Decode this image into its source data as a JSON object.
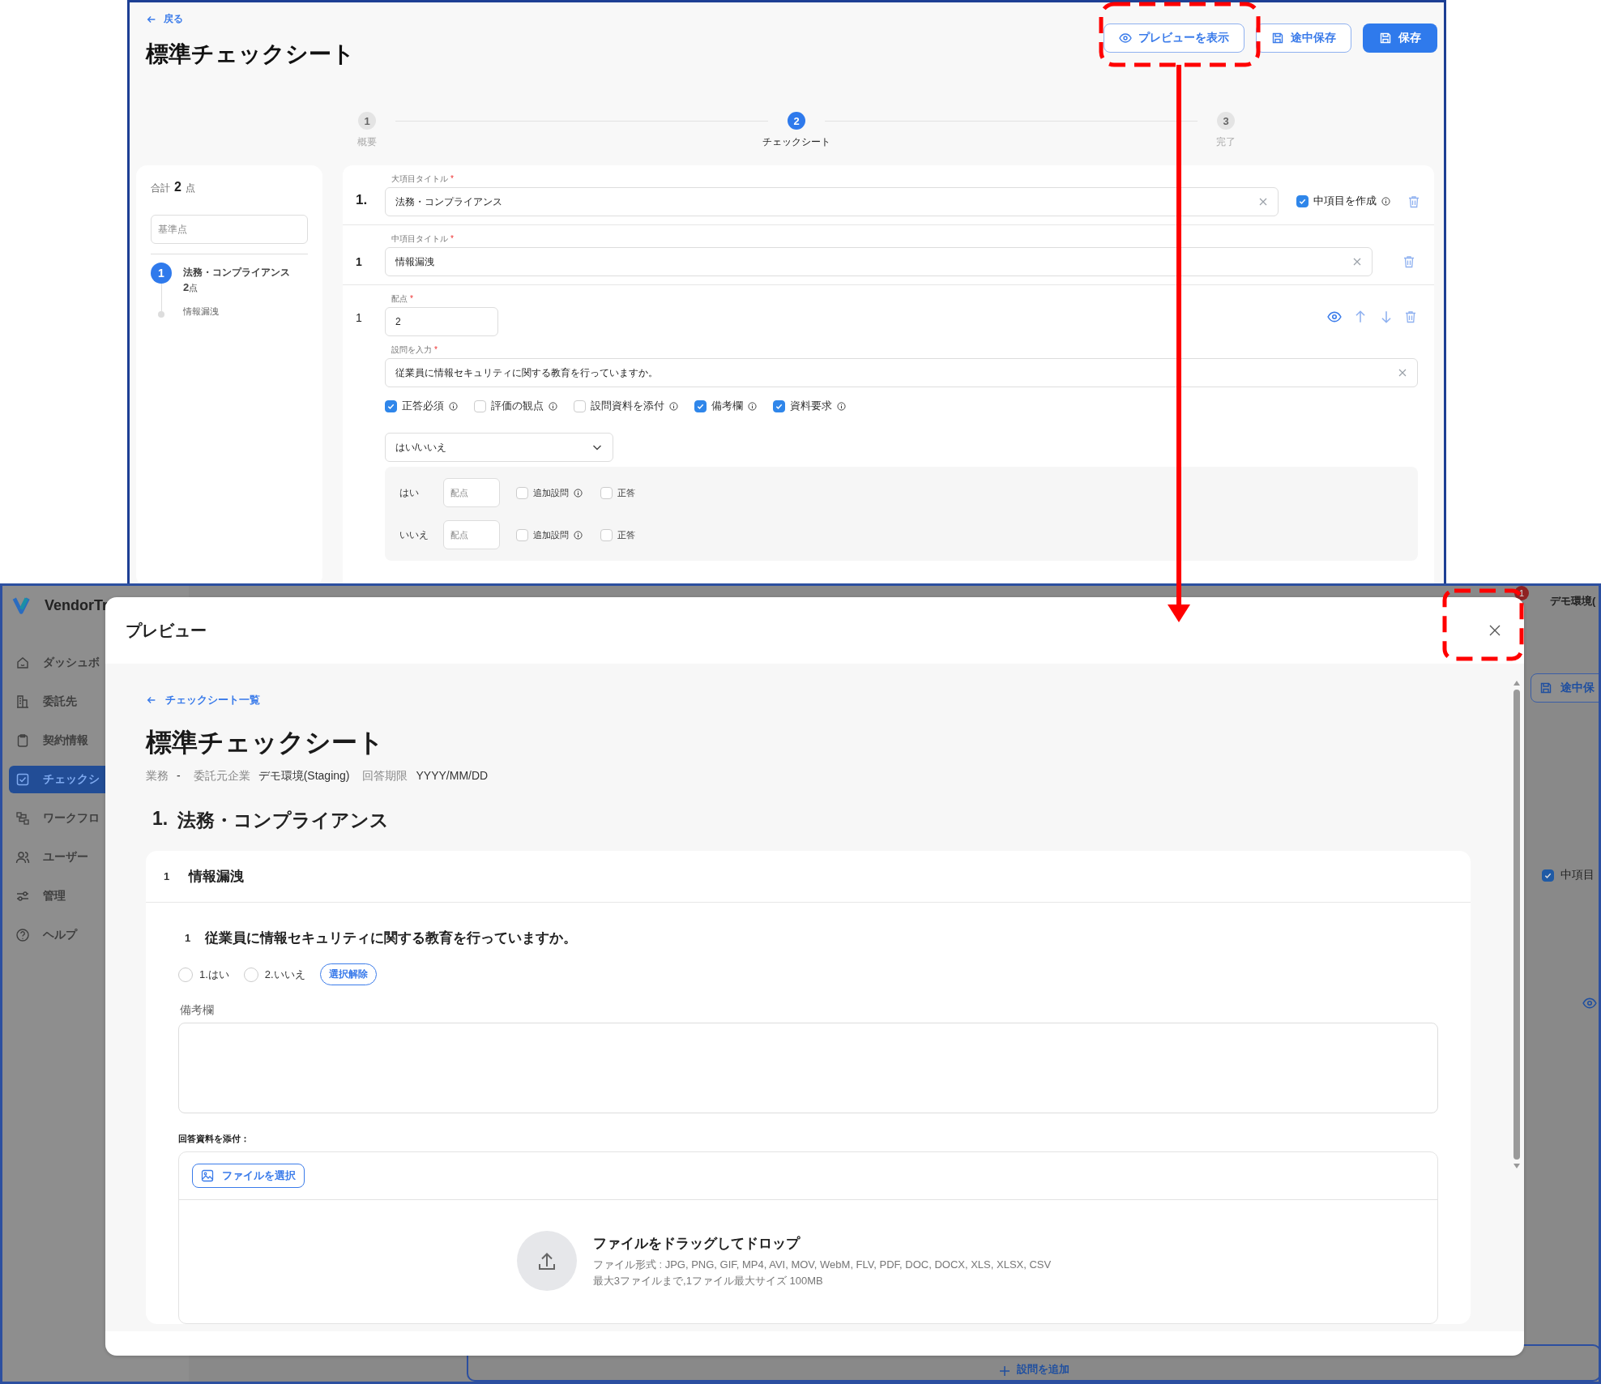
{
  "required_mark": "*",
  "top_screen": {
    "back_link": "戻る",
    "title": "標準チェックシート",
    "buttons": [
      {
        "label": "プレビューを表示",
        "kind": "preview"
      },
      {
        "label": "途中保存",
        "kind": "draft"
      },
      {
        "label": "保存",
        "kind": "save"
      }
    ],
    "steps": [
      {
        "number": "1",
        "label": "概要",
        "selected": false
      },
      {
        "number": "2",
        "label": "チェックシート",
        "selected": true
      },
      {
        "number": "3",
        "label": "完了",
        "selected": false
      }
    ],
    "summary": {
      "total_label": "合計",
      "total_value": "2",
      "total_unit": "点",
      "base_placeholder": "基準点",
      "outline": [
        {
          "number": "1",
          "title": "法務・コンプライアンス",
          "points": "2",
          "unit": "点",
          "children": [
            {
              "title": "情報漏洩"
            }
          ]
        }
      ]
    },
    "major": {
      "number": "1.",
      "label": "大項目タイトル",
      "value": "法務・コンプライアンス",
      "create_middle": {
        "label": "中項目を作成",
        "checked": true
      }
    },
    "middle": {
      "number": "1",
      "label": "中項目タイトル",
      "value": "情報漏洩"
    },
    "question": {
      "number": "1",
      "points_label": "配点",
      "points_value": "2",
      "text_label": "設問を入力",
      "text_value": "従業員に情報セキュリティに関する教育を行っていますか。",
      "options": [
        {
          "label": "正答必須",
          "checked": true
        },
        {
          "label": "評価の観点",
          "checked": false
        },
        {
          "label": "設問資料を添付",
          "checked": false
        },
        {
          "label": "備考欄",
          "checked": true
        },
        {
          "label": "資料要求",
          "checked": true
        }
      ],
      "answer_type": "はい/いいえ",
      "choices": [
        {
          "label": "はい",
          "points_placeholder": "配点",
          "followup_label": "追加設問",
          "followup_checked": false,
          "correct_label": "正答",
          "correct_checked": false
        },
        {
          "label": "いいえ",
          "points_placeholder": "配点",
          "followup_label": "追加設問",
          "followup_checked": false,
          "correct_label": "正答",
          "correct_checked": false
        }
      ]
    }
  },
  "app": {
    "brand": "VendorTr",
    "nav": [
      {
        "label": "ダッシュボ",
        "selected": false
      },
      {
        "label": "委託先",
        "selected": false
      },
      {
        "label": "契約情報",
        "selected": false
      },
      {
        "label": "チェックシ",
        "selected": true
      },
      {
        "label": "ワークフロ",
        "selected": false
      },
      {
        "label": "ユーザー",
        "selected": false
      },
      {
        "label": "管理",
        "selected": false
      },
      {
        "label": "ヘルプ",
        "selected": false
      }
    ],
    "badge": "1",
    "environment": "デモ環境(",
    "draft_button": "途中保",
    "middle_checkbox": {
      "label": "中項目",
      "checked": true
    },
    "add_question": "設問を追加"
  },
  "preview": {
    "title": "プレビュー",
    "back_link": "チェックシート一覧",
    "heading": "標準チェックシート",
    "meta": [
      {
        "label": "業務",
        "value": "-"
      },
      {
        "label": "委託元企業",
        "value": "デモ環境(Staging)"
      },
      {
        "label": "回答期限",
        "value": "YYYY/MM/DD"
      }
    ],
    "section": {
      "number": "1.",
      "title": "法務・コンプライアンス"
    },
    "group": {
      "number": "1",
      "title": "情報漏洩"
    },
    "question": {
      "number": "1",
      "text": "従業員に情報セキュリティに関する教育を行っていますか。",
      "choices": [
        {
          "label": "1.はい",
          "selected": false
        },
        {
          "label": "2.いいえ",
          "selected": false
        }
      ],
      "clear_label": "選択解除",
      "remarks_label": "備考欄",
      "attach_label": "回答資料を添付：",
      "file_button": "ファイルを選択",
      "drop_title": "ファイルをドラッグしてドロップ",
      "drop_formats": "ファイル形式 : JPG, PNG, GIF, MP4, AVI, MOV, WebM, FLV, PDF, DOC, DOCX, XLS, XLSX, CSV",
      "drop_limits": "最大3ファイルまで,1ファイル最大サイズ 100MB"
    }
  }
}
